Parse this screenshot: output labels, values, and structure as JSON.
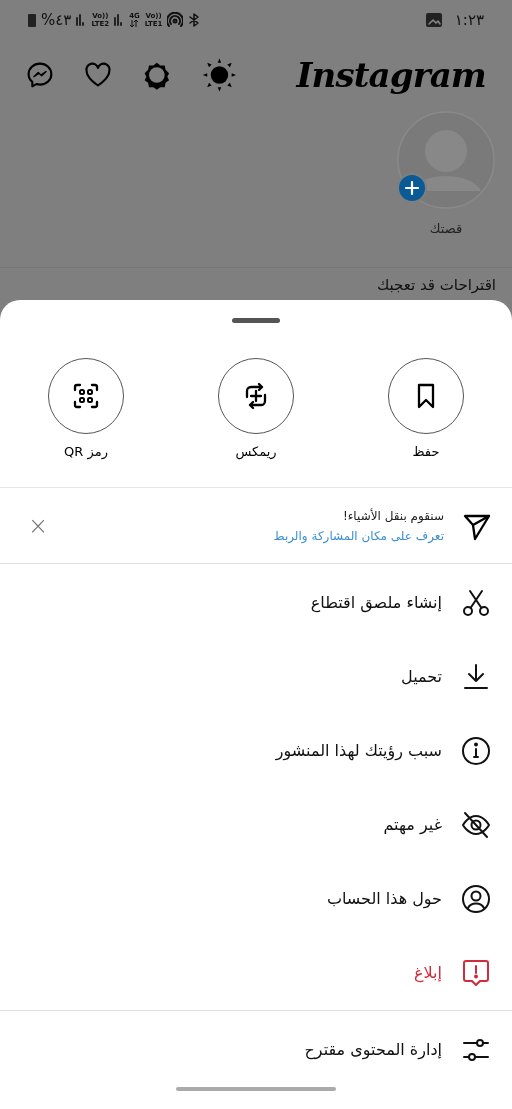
{
  "status_bar": {
    "battery": "%٤٣",
    "networks": [
      {
        "top": "Vo))",
        "bottom": "LTE1"
      },
      {
        "top": "4G"
      },
      {
        "top": "Vo))",
        "bottom": "LTE2"
      }
    ],
    "time": "١:٢٣"
  },
  "header": {
    "logo": "Instagram"
  },
  "story": {
    "label": "قصتك"
  },
  "section_title": "اقتراحات قد تعجبك",
  "sheet": {
    "actions": [
      {
        "label": "حفظ"
      },
      {
        "label": "ريمكس"
      },
      {
        "label": "رمز QR"
      }
    ],
    "banner": {
      "title": "سنقوم بنقل الأشياء!",
      "link": "تعرف على مكان المشاركة والربط",
      "close": "×"
    },
    "sections": [
      [
        {
          "label": "إنشاء ملصق اقتطاع",
          "kind": "normal"
        },
        {
          "label": "تحميل",
          "kind": "normal"
        },
        {
          "label": "سبب رؤيتك لهذا المنشور",
          "kind": "normal"
        },
        {
          "label": "غير مهتم",
          "kind": "normal"
        },
        {
          "label": "حول هذا الحساب",
          "kind": "normal"
        },
        {
          "label": "إبلاغ",
          "kind": "danger"
        }
      ],
      [
        {
          "label": "إدارة المحتوى مقترح",
          "kind": "normal"
        }
      ]
    ]
  }
}
